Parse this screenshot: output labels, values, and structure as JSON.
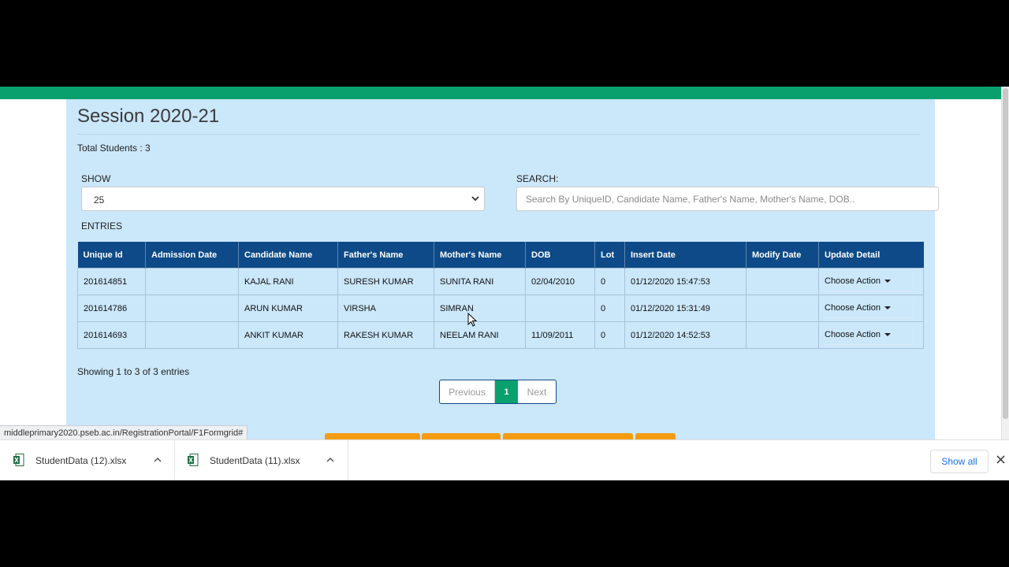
{
  "page": {
    "title": "Session 2020-21",
    "total_students": "Total Students : 3"
  },
  "filters": {
    "show_label": "SHOW",
    "show_value": "25",
    "search_label": "SEARCH:",
    "search_placeholder": "Search By UniqueID, Candidate Name, Father's Name, Mother's Name, DOB..",
    "entries_label": "ENTRIES"
  },
  "table": {
    "columns": [
      "Unique Id",
      "Admission Date",
      "Candidate Name",
      "Father's Name",
      "Mother's Name",
      "DOB",
      "Lot",
      "Insert Date",
      "Modify Date",
      "Update Detail"
    ],
    "rows": [
      [
        "201614851",
        "",
        "KAJAL RANI",
        "SURESH KUMAR",
        "SUNITA RANI",
        "02/04/2010",
        "0",
        "01/12/2020 15:47:53",
        "",
        "Choose Action"
      ],
      [
        "201614786",
        "",
        "ARUN KUMAR",
        "VIRSHA",
        "SIMRAN",
        "",
        "0",
        "01/12/2020 15:31:49",
        "",
        "Choose Action"
      ],
      [
        "201614693",
        "",
        "ANKIT KUMAR",
        "RAKESH KUMAR",
        "NEELAM RANI",
        "11/09/2011",
        "0",
        "01/12/2020 14:52:53",
        "",
        "Choose Action"
      ]
    ]
  },
  "footer": {
    "showing": "Showing 1 to 3 of 3 entries",
    "pagination": {
      "previous": "Previous",
      "current": "1",
      "next": "Next"
    }
  },
  "status_url": "middleprimary2020.pseb.ac.in/RegistrationPortal/F1Formgrid#",
  "downloads": {
    "items": [
      {
        "name": "StudentData (12).xlsx",
        "icon": "excel-file-icon"
      },
      {
        "name": "StudentData (11).xlsx",
        "icon": "excel-file-icon"
      }
    ],
    "show_all": "Show all"
  },
  "colors": {
    "header_green": "#0aa06e",
    "panel_blue": "#cbe7fa",
    "table_header": "#0d4a87",
    "accent_orange": "#f39c12",
    "link_blue": "#1a73e8"
  }
}
